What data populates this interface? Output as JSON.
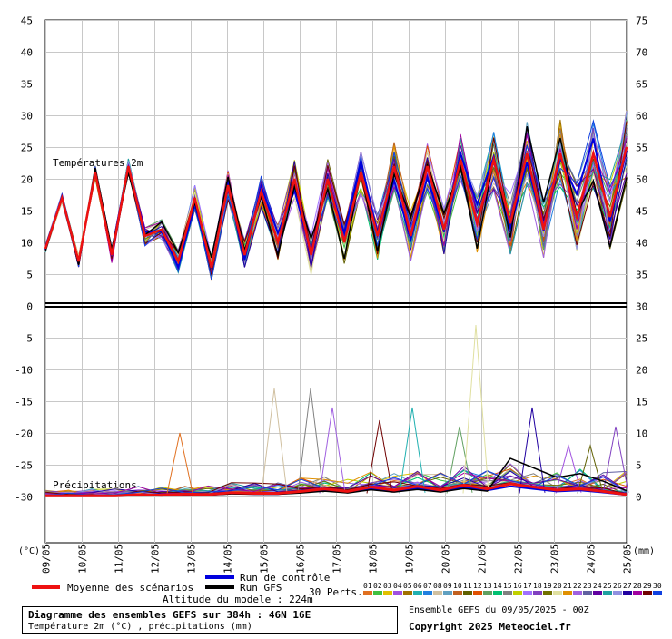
{
  "chart_data": {
    "type": "line",
    "title": "Diagramme des ensembles GEFS sur 384h : 46N 16E",
    "subtitle": "Température 2m (°C) , précipitations (mm)",
    "left_axis_unit": "(°C)",
    "right_axis_unit": "(mm)",
    "left_ticks": [
      45,
      40,
      35,
      30,
      25,
      20,
      15,
      10,
      5,
      0,
      -5,
      -10,
      -15,
      -20,
      -25,
      -30
    ],
    "right_ticks": [
      75,
      70,
      65,
      60,
      55,
      50,
      45,
      40,
      35,
      30,
      25,
      20,
      15,
      10,
      5,
      0
    ],
    "ylim_temperature": [
      0,
      45
    ],
    "ylim_precip_mm": [
      0,
      30
    ],
    "x_labels": [
      "09/05",
      "10/05",
      "11/05",
      "12/05",
      "13/05",
      "14/05",
      "15/05",
      "16/05",
      "17/05",
      "18/05",
      "19/05",
      "20/05",
      "21/05",
      "22/05",
      "23/05",
      "24/05",
      "25/05"
    ],
    "grid": true,
    "panel_labels": {
      "temperature": "Températures 2m",
      "precip": "Précipitations"
    },
    "legend": {
      "mean": "Moyenne des scénarios",
      "control": "Run de contrôle",
      "gfs": "Run GFS",
      "altitude": "Altitude du modele : 224m",
      "perts": "30 Perts.",
      "pert_numbers": [
        "01",
        "02",
        "03",
        "04",
        "05",
        "06",
        "07",
        "08",
        "09",
        "10",
        "11",
        "12",
        "13",
        "14",
        "15",
        "16",
        "17",
        "18",
        "19",
        "20",
        "21",
        "22",
        "23",
        "24",
        "25",
        "26",
        "27",
        "28",
        "29",
        "30"
      ]
    },
    "colors": {
      "mean": "#ee1111",
      "control": "#0000dd",
      "gfs": "#000000",
      "perts": [
        "#e07020",
        "#40c040",
        "#e0c000",
        "#a050e0",
        "#a07000",
        "#20b0b0",
        "#2080e0",
        "#d0c0a0",
        "#60a0c0",
        "#c06020",
        "#606000",
        "#e05000",
        "#60a060",
        "#00c070",
        "#808080",
        "#c0d000",
        "#a070ff",
        "#8040c0",
        "#707000",
        "#e0e0a0",
        "#e09000",
        "#a060e0",
        "#6060a0",
        "#6000a0",
        "#20a0a0",
        "#9090e0",
        "#2000a0",
        "#a000a0",
        "#700000",
        "#1040e0"
      ]
    },
    "temperature_mean": [
      9,
      17,
      7,
      21,
      8,
      22,
      11,
      12,
      7,
      17,
      6,
      19,
      8,
      18,
      10,
      20,
      8,
      20,
      10,
      21,
      11,
      22,
      11,
      22,
      12,
      23,
      13,
      23,
      13,
      24,
      12,
      24,
      14,
      24,
      14,
      25
    ],
    "precip_mean": [
      0.1,
      0.1,
      0.1,
      0.1,
      0.3,
      0.2,
      0.4,
      0.3,
      0.6,
      0.5,
      0.5,
      0.8,
      1.2,
      0.8,
      1.5,
      1.0,
      1.6,
      1.0,
      1.8,
      1.2,
      2.0,
      1.5,
      1.0,
      1.2,
      0.8,
      0.3
    ],
    "precip_peaks": [
      {
        "date_index": 3.7,
        "value": 10
      },
      {
        "date_index": 6.3,
        "value": 17
      },
      {
        "date_index": 7.3,
        "value": 17
      },
      {
        "date_index": 7.9,
        "value": 14
      },
      {
        "date_index": 9.2,
        "value": 12
      },
      {
        "date_index": 10.1,
        "value": 14
      },
      {
        "date_index": 11.4,
        "value": 11
      },
      {
        "date_index": 11.85,
        "value": 27
      },
      {
        "date_index": 13.4,
        "value": 14
      },
      {
        "date_index": 14.4,
        "value": 8
      },
      {
        "date_index": 15.0,
        "value": 8
      },
      {
        "date_index": 15.7,
        "value": 11
      }
    ]
  },
  "footer": {
    "ensemble": "Ensemble GEFS du 09/05/2025 - 00Z",
    "copyright": "Copyright 2025 Meteociel.fr"
  }
}
